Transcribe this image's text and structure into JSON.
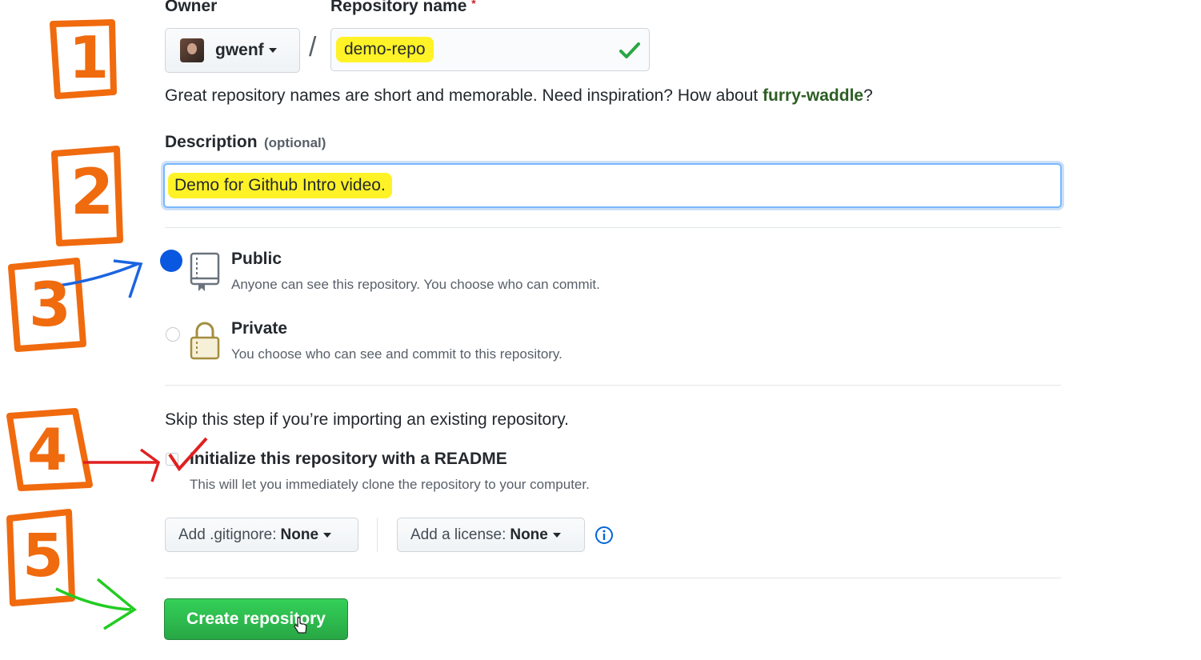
{
  "form": {
    "owner_label": "Owner",
    "repo_name_label": "Repository name",
    "required_mark": "*",
    "owner_value": "gwenf",
    "separator": "/",
    "repo_name_value": "demo-repo",
    "name_hint_prefix": "Great repository names are short and memorable. Need inspiration? How about ",
    "name_suggestion": "furry-waddle",
    "name_hint_suffix": "?",
    "description_label": "Description",
    "description_optional": "(optional)",
    "description_value": "Demo for Github Intro video.",
    "visibility": {
      "public_title": "Public",
      "public_note": "Anyone can see this repository. You choose who can commit.",
      "private_title": "Private",
      "private_note": "You choose who can see and commit to this repository."
    },
    "import_note": "Skip this step if you’re importing an existing repository.",
    "readme_title": "Initialize this repository with a README",
    "readme_note": "This will let you immediately clone the repository to your computer.",
    "gitignore_prefix": "Add .gitignore:",
    "gitignore_value": "None",
    "license_prefix": "Add a license:",
    "license_value": "None",
    "create_button": "Create repository"
  },
  "annotations": {
    "step1": "1",
    "step2": "2",
    "step3": "3",
    "step4": "4",
    "step5": "5"
  },
  "colors": {
    "success_green": "#28a745",
    "suggestion_green": "#2d5e23",
    "highlight_yellow": "#fff000",
    "annotation_orange": "#f06a0e",
    "radio_blue": "#0366d6",
    "arrow_red": "#e02020"
  },
  "icons": {
    "valid": "check-icon",
    "public": "repo-book-icon",
    "private": "lock-icon",
    "info": "info-icon"
  }
}
